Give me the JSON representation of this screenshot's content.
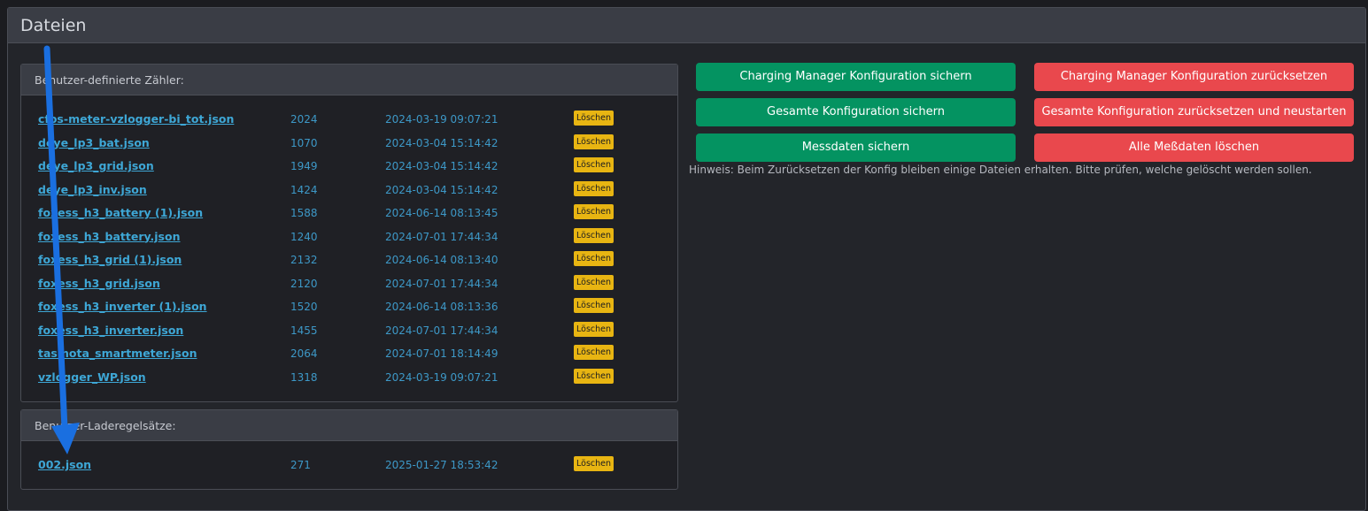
{
  "page": {
    "title": "Dateien"
  },
  "counters_panel": {
    "title": "Benutzer-definierte Zähler:",
    "delete_label": "Löschen",
    "files": [
      {
        "name": "cfos-meter-vzlogger-bi_tot.json",
        "size": "2024",
        "date": "2024-03-19 09:07:21"
      },
      {
        "name": "deye_lp3_bat.json",
        "size": "1070",
        "date": "2024-03-04 15:14:42"
      },
      {
        "name": "deye_lp3_grid.json",
        "size": "1949",
        "date": "2024-03-04 15:14:42"
      },
      {
        "name": "deye_lp3_inv.json",
        "size": "1424",
        "date": "2024-03-04 15:14:42"
      },
      {
        "name": "foxess_h3_battery (1).json",
        "size": "1588",
        "date": "2024-06-14 08:13:45"
      },
      {
        "name": "foxess_h3_battery.json",
        "size": "1240",
        "date": "2024-07-01 17:44:34"
      },
      {
        "name": "foxess_h3_grid (1).json",
        "size": "2132",
        "date": "2024-06-14 08:13:40"
      },
      {
        "name": "foxess_h3_grid.json",
        "size": "2120",
        "date": "2024-07-01 17:44:34"
      },
      {
        "name": "foxess_h3_inverter (1).json",
        "size": "1520",
        "date": "2024-06-14 08:13:36"
      },
      {
        "name": "foxess_h3_inverter.json",
        "size": "1455",
        "date": "2024-07-01 17:44:34"
      },
      {
        "name": "tasmota_smartmeter.json",
        "size": "2064",
        "date": "2024-07-01 18:14:49"
      },
      {
        "name": "vzlogger_WP.json",
        "size": "1318",
        "date": "2024-03-19 09:07:21"
      }
    ]
  },
  "rules_panel": {
    "title": "Benutzer-Laderegelsätze:",
    "delete_label": "Löschen",
    "files": [
      {
        "name": "002.json",
        "size": "271",
        "date": "2025-01-27 18:53:42"
      }
    ]
  },
  "actions": {
    "backup_cm": "Charging Manager Konfiguration sichern",
    "reset_cm": "Charging Manager Konfiguration zurücksetzen",
    "backup_all": "Gesamte Konfiguration sichern",
    "reset_all": "Gesamte Konfiguration zurücksetzen und neustarten",
    "backup_data": "Messdaten sichern",
    "delete_data": "Alle Meßdaten löschen",
    "hint": "Hinweis: Beim Zurücksetzen der Konfig bleiben einige Dateien erhalten. Bitte prüfen, welche gelöscht werden sollen."
  },
  "colors": {
    "green": "#049361",
    "red": "#e9484d",
    "delete_yellow": "#e8b512",
    "link": "#3ea7d6",
    "annotation_arrow": "#1a6fe0"
  }
}
